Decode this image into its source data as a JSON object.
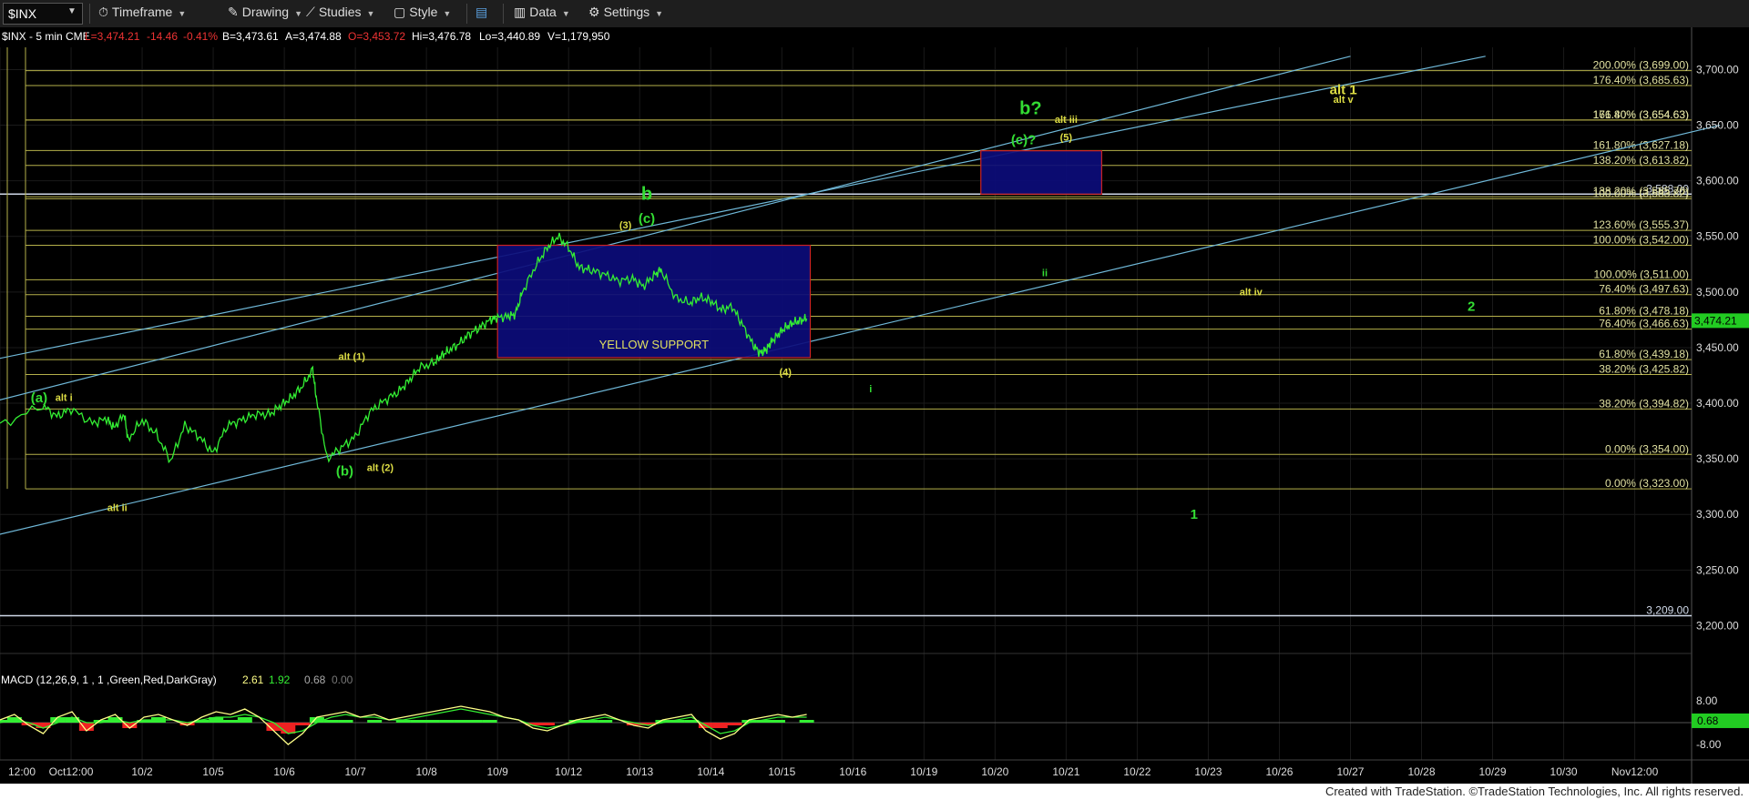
{
  "toolbar": {
    "symbol": "$INX",
    "items": [
      "Timeframe",
      "Drawing",
      "Studies",
      "Style",
      "Data",
      "Settings"
    ]
  },
  "header": {
    "symbol_label": "$INX - 5 min  CME",
    "last": "L=3,474.21",
    "change": "-14.46",
    "change_pct": "-0.41%",
    "bid": "B=3,473.61",
    "ask": "A=3,474.88",
    "low_prev": "O=3,453.72",
    "hi": "Hi=3,476.78",
    "lo": "Lo=3,440.89",
    "volume": "V=1,179,950"
  },
  "colors": {
    "price": "#33ee33",
    "fib_line": "#b5b04a",
    "channel": "#6fb8d8",
    "box_fill": "#0c0c7a",
    "box_border": "#cc2222",
    "label_green": "#33dd33",
    "label_yellow": "#dddd44",
    "macd_line": "#ffff88",
    "macd_signal": "#33ee33",
    "hist_pos": "#33ee33",
    "hist_neg": "#ee2222"
  },
  "chart_data": {
    "type": "line",
    "title": "$INX - 5 min",
    "y_axis": {
      "ylim": [
        3175,
        3720
      ],
      "ticks": [
        "3,700.00",
        "3,650.00",
        "3,600.00",
        "3,550.00",
        "3,500.00",
        "3,450.00",
        "3,400.00",
        "3,350.00",
        "3,300.00",
        "3,250.00",
        "3,200.00"
      ],
      "tick_values": [
        3700,
        3650,
        3600,
        3550,
        3500,
        3450,
        3400,
        3350,
        3300,
        3250,
        3200
      ]
    },
    "x_axis": {
      "ticks": [
        "12:00",
        "Oct12:00",
        "10/2",
        "10/5",
        "10/6",
        "10/7",
        "10/8",
        "10/9",
        "10/12",
        "10/13",
        "10/14",
        "10/15",
        "10/16",
        "10/19",
        "10/20",
        "10/21",
        "10/22",
        "10/23",
        "10/26",
        "10/27",
        "10/28",
        "10/29",
        "10/30",
        "Nov12:00"
      ],
      "tick_index": [
        0,
        1,
        2,
        3,
        4,
        5,
        6,
        7,
        8,
        9,
        10,
        11,
        12,
        13,
        14,
        15,
        16,
        17,
        18,
        19,
        20,
        21,
        22,
        23
      ]
    },
    "price_series": {
      "name": "$INX",
      "x": [
        0,
        0.6,
        0.8,
        1.0,
        1.3,
        1.5,
        1.6,
        1.75,
        1.8,
        2.0,
        2.2,
        2.4,
        2.6,
        2.8,
        3.0,
        3.2,
        3.4,
        3.6,
        3.8,
        3.95,
        4.1,
        4.25,
        4.4,
        4.45,
        4.6,
        4.8,
        5.0,
        5.2,
        5.4,
        5.6,
        5.75,
        5.9,
        6.1,
        6.2,
        6.3,
        6.45,
        6.6,
        6.75,
        6.9,
        7.0,
        7.15,
        7.25,
        7.35,
        7.55,
        7.7,
        7.85,
        8.0,
        8.15,
        8.3,
        8.5,
        8.7,
        8.9,
        9.05,
        9.2,
        9.3,
        9.5,
        9.7,
        9.85,
        10.0,
        10.15,
        10.3,
        10.45,
        10.6,
        10.7,
        10.78,
        10.85,
        10.95,
        11.05,
        11.15,
        11.25,
        11.35
      ],
      "y": [
        3380,
        3398,
        3388,
        3395,
        3382,
        3386,
        3378,
        3390,
        3367,
        3385,
        3372,
        3348,
        3380,
        3370,
        3355,
        3380,
        3385,
        3390,
        3390,
        3398,
        3405,
        3415,
        3430,
        3405,
        3350,
        3360,
        3370,
        3392,
        3402,
        3410,
        3420,
        3432,
        3436,
        3442,
        3447,
        3453,
        3462,
        3468,
        3475,
        3477,
        3478,
        3480,
        3500,
        3525,
        3540,
        3550,
        3540,
        3522,
        3520,
        3516,
        3510,
        3512,
        3505,
        3515,
        3520,
        3495,
        3490,
        3495,
        3492,
        3484,
        3487,
        3470,
        3452,
        3445,
        3448,
        3455,
        3462,
        3468,
        3472,
        3474,
        3476
      ]
    },
    "horizontal_levels": [
      {
        "label": "200.00% (3,699.00)",
        "value": 3699
      },
      {
        "label": "176.40% (3,685.63)",
        "value": 3685.63
      },
      {
        "label": "161.80% (3,654.63)",
        "value": 3654.63
      },
      {
        "label": "176.40% (3,654.63)",
        "value": 3654.63
      },
      {
        "label": "161.80% (3,627.18)",
        "value": 3627.18
      },
      {
        "label": "138.20% (3,613.82)",
        "value": 3613.82
      },
      {
        "label": "3,588.00",
        "value": 3588
      },
      {
        "label": "138.20% (3,585.70)",
        "value": 3585.7
      },
      {
        "label": "100.00% (3,583.82)",
        "value": 3583.82
      },
      {
        "label": "123.60% (3,555.37)",
        "value": 3555.37
      },
      {
        "label": "100.00% (3,542.00)",
        "value": 3542
      },
      {
        "label": "100.00% (3,511.00)",
        "value": 3511
      },
      {
        "label": "76.40% (3,497.63)",
        "value": 3497.63
      },
      {
        "label": "61.80% (3,478.18)",
        "value": 3478.18
      },
      {
        "label": "76.40% (3,466.63)",
        "value": 3466.63
      },
      {
        "label": "61.80% (3,439.18)",
        "value": 3439.18
      },
      {
        "label": "38.20% (3,425.82)",
        "value": 3425.82
      },
      {
        "label": "38.20% (3,394.82)",
        "value": 3394.82
      },
      {
        "label": "0.00% (3,354.00)",
        "value": 3354
      },
      {
        "label": "0.00% (3,323.00)",
        "value": 3323
      },
      {
        "label": "3,209.00",
        "value": 3209
      }
    ],
    "current_price_label": "3,474.21",
    "boxes": [
      {
        "x0": 7.0,
        "x1": 11.4,
        "y0": 3441,
        "y1": 3542,
        "label": "YELLOW SUPPORT"
      },
      {
        "x0": 13.8,
        "x1": 15.5,
        "y0": 3588,
        "y1": 3627
      }
    ],
    "wave_labels": [
      {
        "text": "(a)",
        "x": 0.55,
        "y": 3401,
        "color": "green"
      },
      {
        "text": "alt i",
        "x": 0.9,
        "y": 3402,
        "color": "yellow"
      },
      {
        "text": "alt ii",
        "x": 1.65,
        "y": 3303,
        "color": "yellow"
      },
      {
        "text": "alt (1)",
        "x": 4.95,
        "y": 3439,
        "color": "yellow"
      },
      {
        "text": "(b)",
        "x": 4.85,
        "y": 3335,
        "color": "green"
      },
      {
        "text": "alt (2)",
        "x": 5.35,
        "y": 3339,
        "color": "yellow"
      },
      {
        "text": "b",
        "x": 9.1,
        "y": 3583,
        "color": "green"
      },
      {
        "text": "(3)",
        "x": 8.8,
        "y": 3557,
        "color": "yellow"
      },
      {
        "text": "(c)",
        "x": 9.1,
        "y": 3562,
        "color": "green"
      },
      {
        "text": "(4)",
        "x": 11.05,
        "y": 3425,
        "color": "yellow"
      },
      {
        "text": "i",
        "x": 12.25,
        "y": 3410,
        "color": "green"
      },
      {
        "text": "ii",
        "x": 14.7,
        "y": 3514,
        "color": "green"
      },
      {
        "text": "b?",
        "x": 14.5,
        "y": 3660,
        "color": "green"
      },
      {
        "text": "(c)?",
        "x": 14.4,
        "y": 3633,
        "color": "green"
      },
      {
        "text": "alt iii",
        "x": 15.0,
        "y": 3652,
        "color": "yellow"
      },
      {
        "text": "(5)",
        "x": 15.0,
        "y": 3636,
        "color": "yellow"
      },
      {
        "text": "alt iv",
        "x": 17.6,
        "y": 3497,
        "color": "yellow"
      },
      {
        "text": "2",
        "x": 20.7,
        "y": 3483,
        "color": "green"
      },
      {
        "text": "alt 1",
        "x": 18.9,
        "y": 3678,
        "color": "yellow"
      },
      {
        "text": "alt v",
        "x": 18.9,
        "y": 3670,
        "color": "yellow"
      },
      {
        "text": "1",
        "x": 16.8,
        "y": 3296,
        "color": "green"
      }
    ],
    "channel_lines": [
      {
        "x0": -0.8,
        "y0": 3390,
        "x1": 19.0,
        "y1": 3712
      },
      {
        "x0": -0.8,
        "y0": 3430,
        "x1": 20.9,
        "y1": 3712
      },
      {
        "x0": -0.8,
        "y0": 3270,
        "x1": 24.2,
        "y1": 3650
      }
    ]
  },
  "macd": {
    "label": "MACD (12,26,9, 1 , 1 ,Green,Red,DarkGray)",
    "val1": "2.61",
    "val2": "1.92",
    "val3": "0.68",
    "val4": "0.00",
    "ticks": [
      "8.00",
      "0.68",
      "-8.00"
    ],
    "tick_values": [
      8,
      0.68,
      -8
    ],
    "ylim": [
      -12,
      12
    ],
    "line": [
      1,
      3,
      -1,
      -4,
      2,
      4,
      -3,
      1,
      3,
      -2,
      2,
      3,
      1,
      -1,
      2,
      4,
      3,
      5,
      2,
      -3,
      -8,
      -4,
      2,
      3,
      4,
      2,
      3,
      1,
      2,
      3,
      4,
      5,
      6,
      5,
      4,
      2,
      1,
      -2,
      -3,
      -1,
      1,
      2,
      3,
      1,
      -1,
      -2,
      1,
      2,
      3,
      -3,
      -6,
      -4,
      1,
      2,
      3,
      2,
      3
    ],
    "signal": [
      0,
      1,
      0,
      -2,
      0,
      2,
      0,
      0,
      1,
      0,
      1,
      1,
      1,
      0,
      1,
      2,
      2,
      3,
      2,
      0,
      -4,
      -3,
      0,
      2,
      3,
      2,
      2,
      1,
      1,
      2,
      3,
      4,
      5,
      4,
      3,
      2,
      1,
      -1,
      -2,
      -1,
      0,
      1,
      2,
      1,
      0,
      -1,
      0,
      1,
      2,
      -1,
      -4,
      -3,
      0,
      1,
      2,
      2,
      2
    ],
    "x_span": [
      0,
      11.35
    ]
  },
  "footer": "Created with TradeStation. ©TradeStation Technologies, Inc. All rights reserved."
}
